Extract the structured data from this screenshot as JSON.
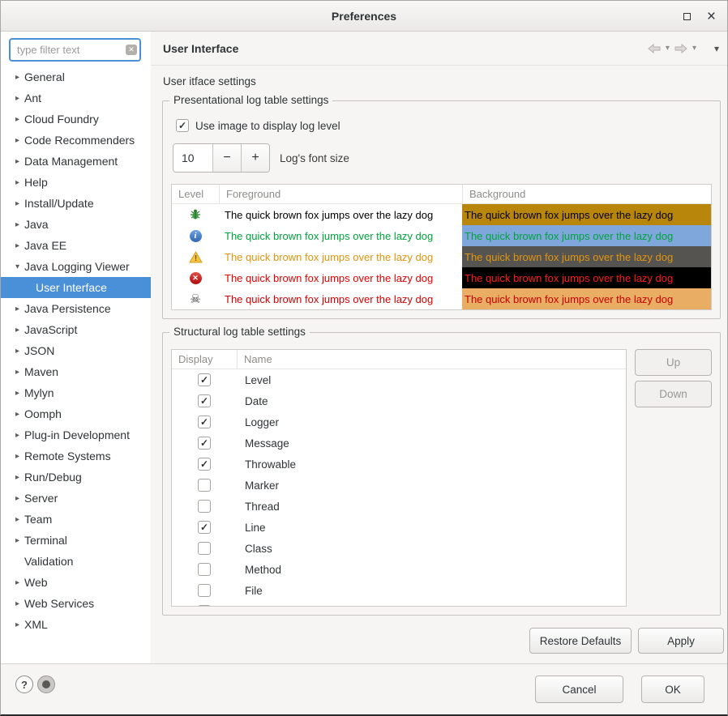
{
  "window": {
    "title": "Preferences"
  },
  "icons": {
    "collapsed": "▸",
    "expanded": "▾",
    "check": "✓",
    "caret_down": "▾",
    "close": "×",
    "clear": "✕",
    "help": "?",
    "minus": "−",
    "plus": "+",
    "skull": "☠",
    "info_glyph": "i",
    "warn_glyph": "!",
    "error_glyph": "✕"
  },
  "sidebar": {
    "filter": {
      "placeholder": "type filter text"
    },
    "items": [
      {
        "label": "General",
        "expandable": true,
        "expanded": false,
        "level": 0,
        "selected": false
      },
      {
        "label": "Ant",
        "expandable": true,
        "expanded": false,
        "level": 0,
        "selected": false
      },
      {
        "label": "Cloud Foundry",
        "expandable": true,
        "expanded": false,
        "level": 0,
        "selected": false
      },
      {
        "label": "Code Recommenders",
        "expandable": true,
        "expanded": false,
        "level": 0,
        "selected": false
      },
      {
        "label": "Data Management",
        "expandable": true,
        "expanded": false,
        "level": 0,
        "selected": false
      },
      {
        "label": "Help",
        "expandable": true,
        "expanded": false,
        "level": 0,
        "selected": false
      },
      {
        "label": "Install/Update",
        "expandable": true,
        "expanded": false,
        "level": 0,
        "selected": false
      },
      {
        "label": "Java",
        "expandable": true,
        "expanded": false,
        "level": 0,
        "selected": false
      },
      {
        "label": "Java EE",
        "expandable": true,
        "expanded": false,
        "level": 0,
        "selected": false
      },
      {
        "label": "Java Logging Viewer",
        "expandable": true,
        "expanded": true,
        "level": 0,
        "selected": false
      },
      {
        "label": "User Interface",
        "expandable": false,
        "expanded": false,
        "level": 1,
        "selected": true
      },
      {
        "label": "Java Persistence",
        "expandable": true,
        "expanded": false,
        "level": 0,
        "selected": false
      },
      {
        "label": "JavaScript",
        "expandable": true,
        "expanded": false,
        "level": 0,
        "selected": false
      },
      {
        "label": "JSON",
        "expandable": true,
        "expanded": false,
        "level": 0,
        "selected": false
      },
      {
        "label": "Maven",
        "expandable": true,
        "expanded": false,
        "level": 0,
        "selected": false
      },
      {
        "label": "Mylyn",
        "expandable": true,
        "expanded": false,
        "level": 0,
        "selected": false
      },
      {
        "label": "Oomph",
        "expandable": true,
        "expanded": false,
        "level": 0,
        "selected": false
      },
      {
        "label": "Plug-in Development",
        "expandable": true,
        "expanded": false,
        "level": 0,
        "selected": false
      },
      {
        "label": "Remote Systems",
        "expandable": true,
        "expanded": false,
        "level": 0,
        "selected": false
      },
      {
        "label": "Run/Debug",
        "expandable": true,
        "expanded": false,
        "level": 0,
        "selected": false
      },
      {
        "label": "Server",
        "expandable": true,
        "expanded": false,
        "level": 0,
        "selected": false
      },
      {
        "label": "Team",
        "expandable": true,
        "expanded": false,
        "level": 0,
        "selected": false
      },
      {
        "label": "Terminal",
        "expandable": true,
        "expanded": false,
        "level": 0,
        "selected": false
      },
      {
        "label": "Validation",
        "expandable": false,
        "expanded": false,
        "level": 0,
        "selected": false
      },
      {
        "label": "Web",
        "expandable": true,
        "expanded": false,
        "level": 0,
        "selected": false
      },
      {
        "label": "Web Services",
        "expandable": true,
        "expanded": false,
        "level": 0,
        "selected": false
      },
      {
        "label": "XML",
        "expandable": true,
        "expanded": false,
        "level": 0,
        "selected": false
      }
    ]
  },
  "header": {
    "title": "User Interface"
  },
  "content": {
    "subtitle": "User itface settings",
    "presentational": {
      "group_label": "Presentational log table settings",
      "use_image_checkbox": {
        "label": "Use image to display log level",
        "checked": true
      },
      "font_size": {
        "value": "10",
        "label": "Log's font size"
      },
      "table": {
        "columns": [
          "Level",
          "Foreground",
          "Background"
        ],
        "sample_text": "The quick brown fox jumps over the lazy dog",
        "rows": [
          {
            "level": "debug",
            "icon": "bug",
            "fg_color": "#000000",
            "bg_fill": "#b8860b",
            "bg_text": "#000000"
          },
          {
            "level": "info",
            "icon": "info",
            "fg_color": "#00a33c",
            "bg_fill": "#7fa7dc",
            "bg_text": "#00a33c"
          },
          {
            "level": "warn",
            "icon": "warning",
            "fg_color": "#e0950f",
            "bg_fill": "#565451",
            "bg_text": "#e0950f"
          },
          {
            "level": "error",
            "icon": "error",
            "fg_color": "#e60000",
            "bg_fill": "#000000",
            "bg_text": "#ff1a1a"
          },
          {
            "level": "fatal",
            "icon": "skull",
            "fg_color": "#d40000",
            "bg_fill": "#e9ad63",
            "bg_text": "#c40000"
          }
        ]
      }
    },
    "structural": {
      "group_label": "Structural log table settings",
      "table": {
        "columns": [
          "Display",
          "Name"
        ],
        "rows": [
          {
            "name": "Level",
            "checked": true
          },
          {
            "name": "Date",
            "checked": true
          },
          {
            "name": "Logger",
            "checked": true
          },
          {
            "name": "Message",
            "checked": true
          },
          {
            "name": "Throwable",
            "checked": true
          },
          {
            "name": "Marker",
            "checked": false
          },
          {
            "name": "Thread",
            "checked": false
          },
          {
            "name": "Line",
            "checked": true
          },
          {
            "name": "Class",
            "checked": false
          },
          {
            "name": "Method",
            "checked": false
          },
          {
            "name": "File",
            "checked": false
          },
          {
            "name": "",
            "checked": false
          }
        ]
      },
      "up_button": "Up",
      "down_button": "Down"
    },
    "restore_defaults_button": "Restore Defaults",
    "apply_button": "Apply"
  },
  "footer": {
    "cancel_button": "Cancel",
    "ok_button": "OK"
  }
}
